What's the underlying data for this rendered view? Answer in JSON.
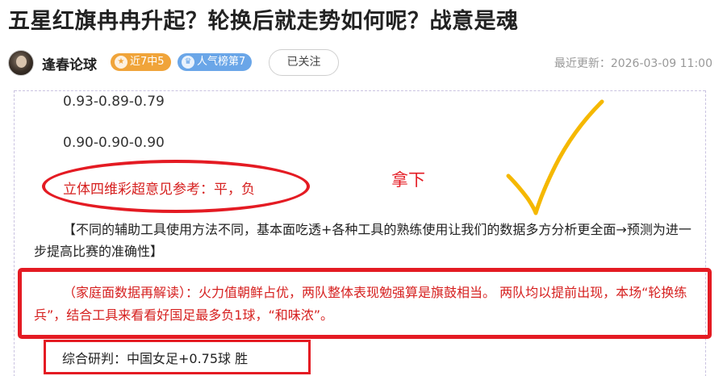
{
  "article": {
    "title": "五星红旗冉冉升起？轮换后就走势如何呢？战意是魂"
  },
  "author": {
    "name": "逢春论球",
    "badge_streak": "近7中5",
    "badge_rank": "人气榜第7",
    "follow_label": "已关注",
    "update_time": "最近更新：2026-03-09 11:00"
  },
  "content": {
    "odds_line_1": "0.93-0.89-0.79",
    "odds_line_2": "0.90-0.90-0.90",
    "reference": "立体四维彩超意见参考：平，负",
    "handwritten_note": "拿下",
    "tools_paragraph": "【不同的辅助工具使用方法不同，基本面吃透+各种工具的熟练使用让我们的数据多方分析更全面→预测为进一步提高比赛的准确性】",
    "analysis": "（家庭面数据再解读）：火力值朝鲜占优，两队整体表现勉强算是旗鼓相当。 两队均以提前出现，本场“轮换练兵”，结合工具来看看好国足最多负1球，“和味浓”。",
    "verdict": "综合研判：中国女足+0.75球  胜"
  },
  "colors": {
    "annotation_red": "#e41b23",
    "check_yellow": "#f5b800",
    "badge_streak": "#f0a43a",
    "badge_rank": "#6aa6e8"
  }
}
